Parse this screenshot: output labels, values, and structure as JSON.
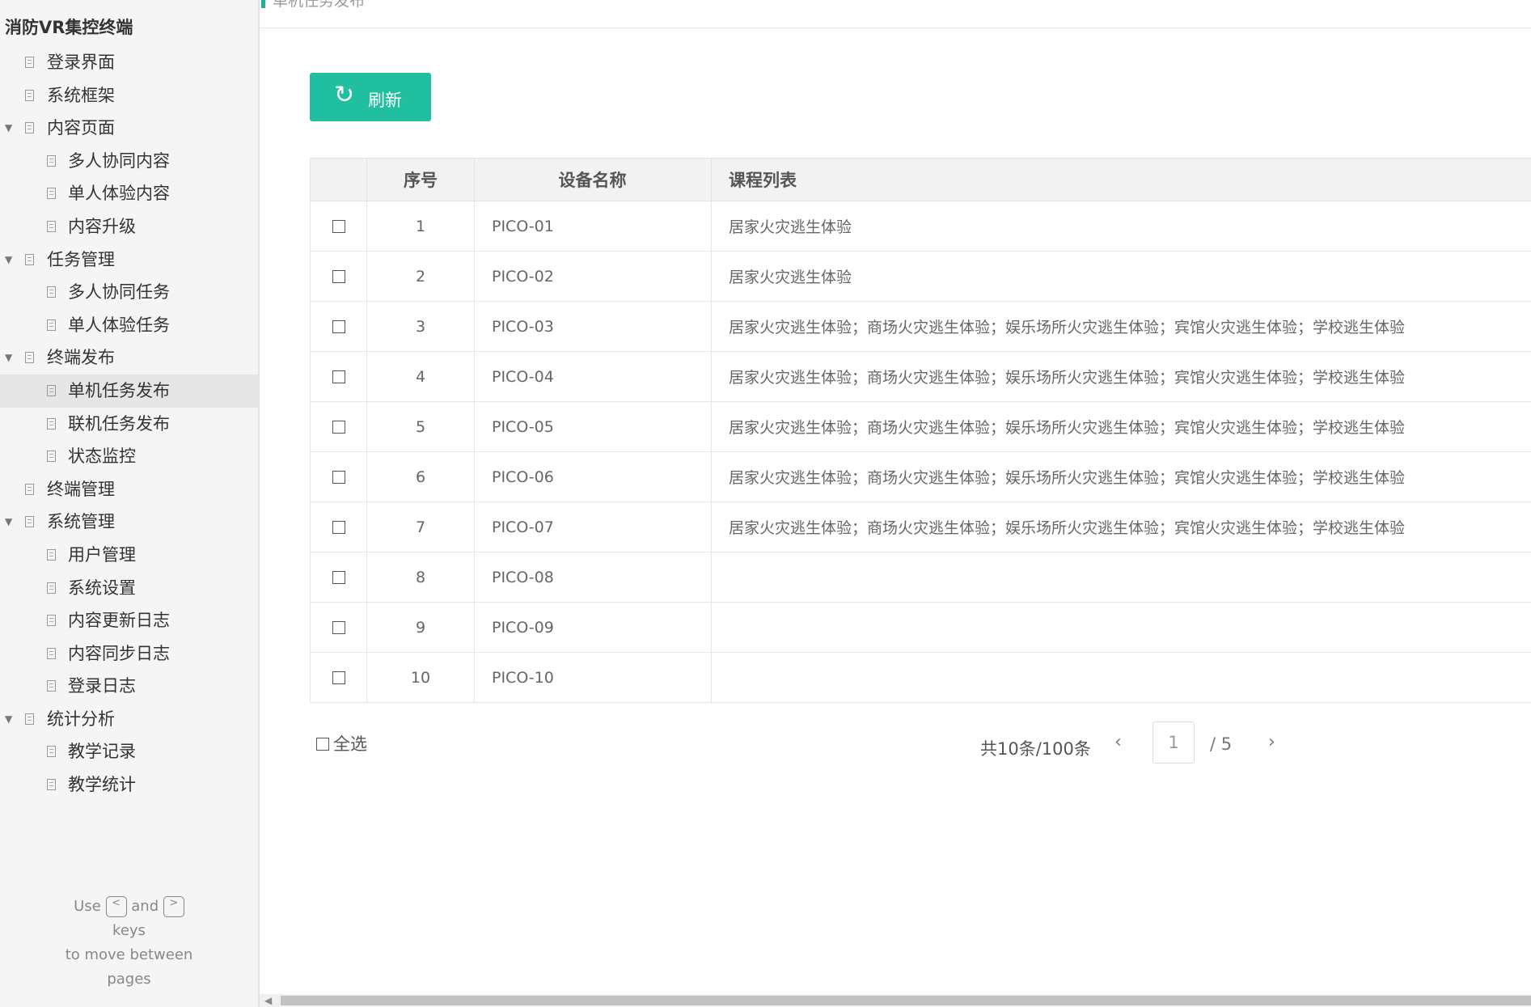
{
  "sidebar": {
    "title": "消防VR集控终端",
    "items": [
      {
        "label": "登录界面",
        "level": 1,
        "expandable": false
      },
      {
        "label": "系统框架",
        "level": 1,
        "expandable": false
      },
      {
        "label": "内容页面",
        "level": 1,
        "expandable": true
      },
      {
        "label": "多人协同内容",
        "level": 2,
        "expandable": false
      },
      {
        "label": "单人体验内容",
        "level": 2,
        "expandable": false
      },
      {
        "label": "内容升级",
        "level": 2,
        "expandable": false
      },
      {
        "label": "任务管理",
        "level": 1,
        "expandable": true
      },
      {
        "label": "多人协同任务",
        "level": 2,
        "expandable": false
      },
      {
        "label": "单人体验任务",
        "level": 2,
        "expandable": false
      },
      {
        "label": "终端发布",
        "level": 1,
        "expandable": true
      },
      {
        "label": "单机任务发布",
        "level": 2,
        "expandable": false,
        "active": true
      },
      {
        "label": "联机任务发布",
        "level": 2,
        "expandable": false
      },
      {
        "label": "状态监控",
        "level": 2,
        "expandable": false
      },
      {
        "label": "终端管理",
        "level": 1,
        "expandable": false
      },
      {
        "label": "系统管理",
        "level": 1,
        "expandable": true
      },
      {
        "label": "用户管理",
        "level": 2,
        "expandable": false
      },
      {
        "label": "系统设置",
        "level": 2,
        "expandable": false
      },
      {
        "label": "内容更新日志",
        "level": 2,
        "expandable": false
      },
      {
        "label": "内容同步日志",
        "level": 2,
        "expandable": false
      },
      {
        "label": "登录日志",
        "level": 2,
        "expandable": false
      },
      {
        "label": "统计分析",
        "level": 1,
        "expandable": true
      },
      {
        "label": "教学记录",
        "level": 2,
        "expandable": false
      },
      {
        "label": "教学统计",
        "level": 2,
        "expandable": false
      }
    ],
    "hint": {
      "use": "Use",
      "prev_key": "<",
      "and": "and",
      "next_key": ">",
      "keys": "keys",
      "line2": "to move between",
      "line3": "pages"
    }
  },
  "header": {
    "breadcrumb": "单机任务发布"
  },
  "toolbar": {
    "refresh_icon": "↻",
    "refresh_label": "刷新"
  },
  "table": {
    "headers": {
      "no": "序号",
      "device": "设备名称",
      "courses": "课程列表"
    },
    "rows": [
      {
        "no": "1",
        "device": "PICO-01",
        "courses": "居家火灾逃生体验"
      },
      {
        "no": "2",
        "device": "PICO-02",
        "courses": "居家火灾逃生体验"
      },
      {
        "no": "3",
        "device": "PICO-03",
        "courses": "居家火灾逃生体验；商场火灾逃生体验；娱乐场所火灾逃生体验；宾馆火灾逃生体验；学校逃生体验"
      },
      {
        "no": "4",
        "device": "PICO-04",
        "courses": "居家火灾逃生体验；商场火灾逃生体验；娱乐场所火灾逃生体验；宾馆火灾逃生体验；学校逃生体验"
      },
      {
        "no": "5",
        "device": "PICO-05",
        "courses": "居家火灾逃生体验；商场火灾逃生体验；娱乐场所火灾逃生体验；宾馆火灾逃生体验；学校逃生体验"
      },
      {
        "no": "6",
        "device": "PICO-06",
        "courses": "居家火灾逃生体验；商场火灾逃生体验；娱乐场所火灾逃生体验；宾馆火灾逃生体验；学校逃生体验"
      },
      {
        "no": "7",
        "device": "PICO-07",
        "courses": "居家火灾逃生体验；商场火灾逃生体验；娱乐场所火灾逃生体验；宾馆火灾逃生体验；学校逃生体验"
      },
      {
        "no": "8",
        "device": "PICO-08",
        "courses": ""
      },
      {
        "no": "9",
        "device": "PICO-09",
        "courses": ""
      },
      {
        "no": "10",
        "device": "PICO-10",
        "courses": ""
      }
    ]
  },
  "footer": {
    "select_all_label": "全选",
    "summary": "共10条/100条",
    "prev": "‹",
    "current_page": "1",
    "total_pages": "/ 5",
    "next": "›"
  },
  "colors": {
    "accent": "#1fbf9f",
    "sidebar_bg": "#f5f5f5",
    "active_item_bg": "#e6e6e6"
  }
}
